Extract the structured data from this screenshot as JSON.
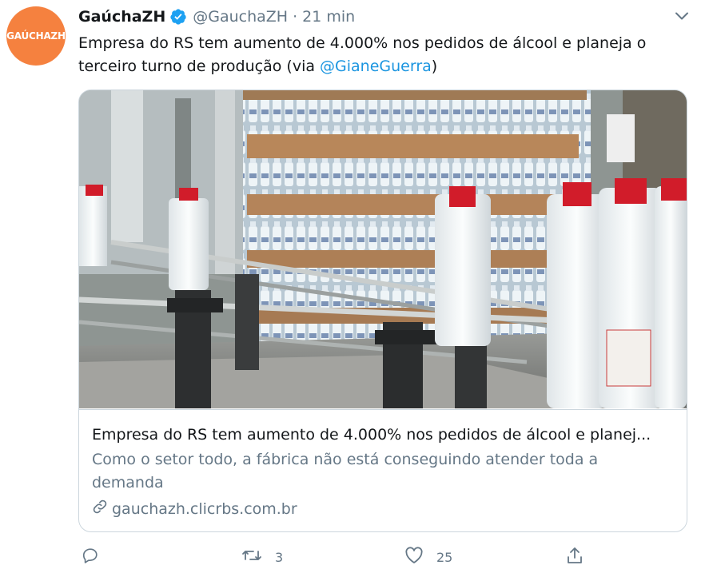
{
  "tweet": {
    "avatar_text": "GAÚCHAZH",
    "display_name": "GaúchaZH",
    "handle": "@GauchaZH",
    "separator": "·",
    "time": "21 min",
    "text_before": "Empresa do RS tem aumento de 4.000% nos pedidos de álcool e planeja o terceiro turno de produção (via ",
    "mention": "@GianeGuerra",
    "text_after": ")"
  },
  "card": {
    "title": "Empresa do RS tem aumento de 4.000% nos pedidos de álcool e planej...",
    "description": "Como o setor todo, a fábrica não está conseguindo atender toda a demanda",
    "domain": "gauchazh.clicrbs.com.br"
  },
  "actions": {
    "reply_count": "",
    "retweet_count": "3",
    "like_count": "25"
  },
  "colors": {
    "brand_orange": "#f5813f",
    "verified_blue": "#1da1f2",
    "link_blue": "#1b95e0",
    "secondary_text": "#657786"
  },
  "icons": [
    "verified-badge-icon",
    "chevron-down-icon",
    "link-icon",
    "reply-icon",
    "retweet-icon",
    "like-icon",
    "share-icon"
  ]
}
